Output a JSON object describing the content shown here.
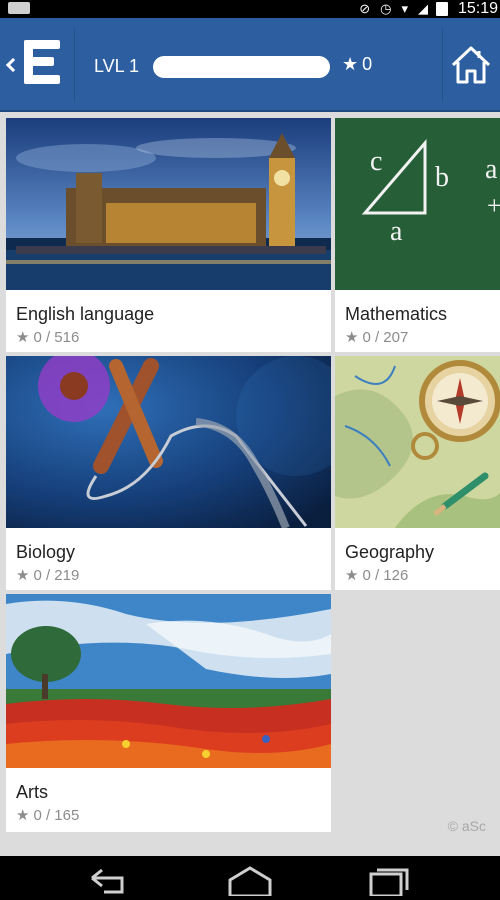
{
  "status_bar": {
    "time": "15:19",
    "icons": [
      "sync-icon",
      "alarm-icon",
      "wifi-icon",
      "signal-icon",
      "battery-icon"
    ]
  },
  "header": {
    "level_label": "LVL 1",
    "progress": 0,
    "stars_count": "0",
    "bg_color": "#2d5fa0"
  },
  "categories": [
    {
      "title": "English language",
      "progress": "0 / 516"
    },
    {
      "title": "Mathematics",
      "progress": "0 / 207"
    },
    {
      "title": "Biology",
      "progress": "0 / 219"
    },
    {
      "title": "Geography",
      "progress": "0 / 126"
    },
    {
      "title": "Arts",
      "progress": "0 / 165"
    }
  ],
  "watermark": "© aSc"
}
